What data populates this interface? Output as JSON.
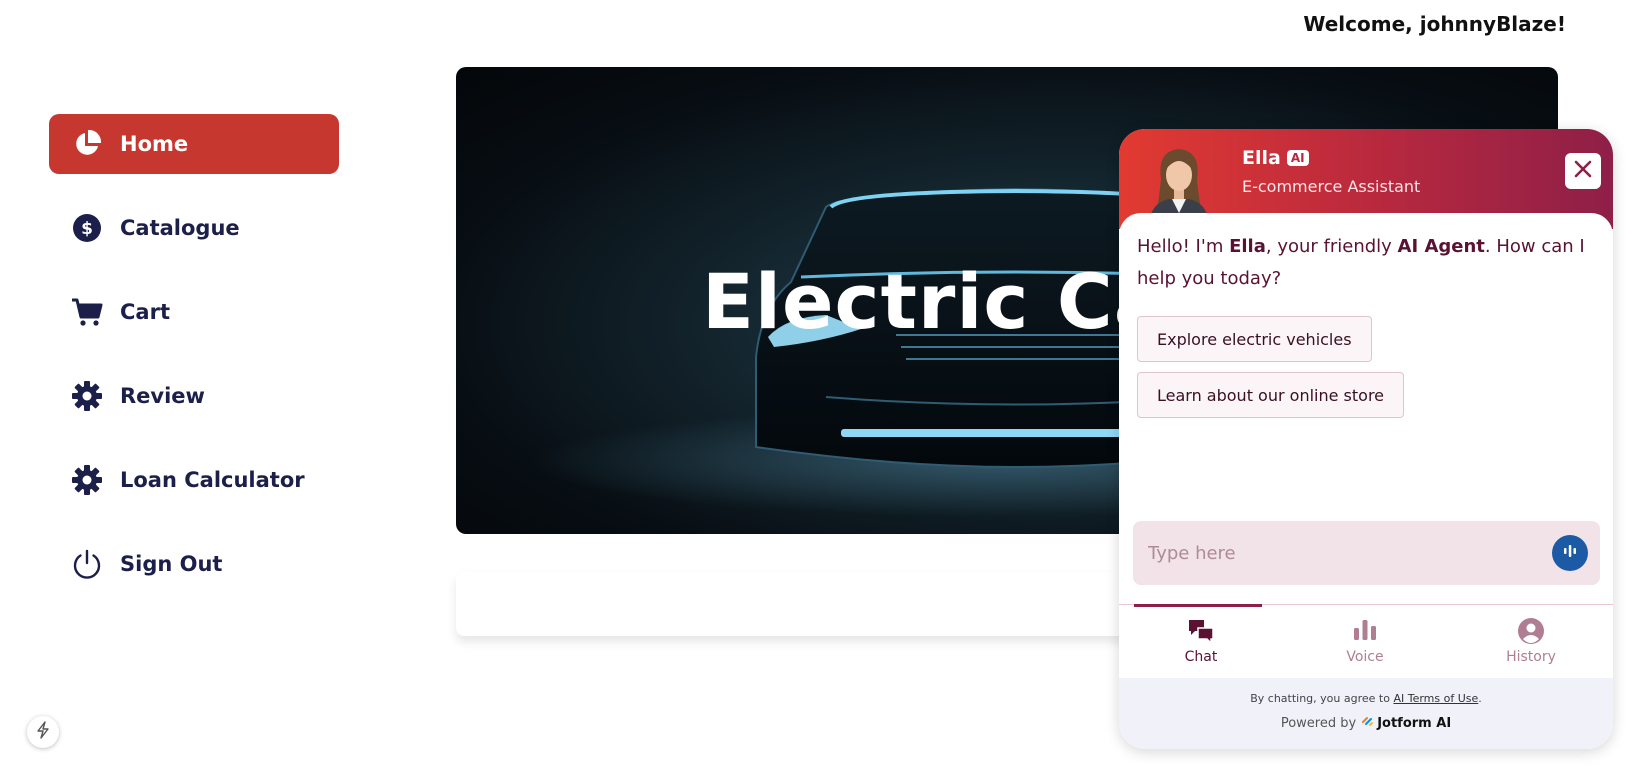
{
  "header": {
    "welcome": "Welcome, johnnyBlaze!"
  },
  "sidebar": {
    "items": [
      {
        "label": "Home",
        "icon": "pie-chart-icon",
        "active": true
      },
      {
        "label": "Catalogue",
        "icon": "dollar-icon"
      },
      {
        "label": "Cart",
        "icon": "cart-icon"
      },
      {
        "label": "Review",
        "icon": "gear-icon"
      },
      {
        "label": "Loan Calculator",
        "icon": "gear-icon"
      },
      {
        "label": "Sign Out",
        "icon": "power-icon"
      }
    ]
  },
  "hero": {
    "title": "Electric Cars"
  },
  "chat": {
    "agent_name": "Ella",
    "ai_badge": "AI",
    "agent_role": "E-commerce Assistant",
    "greeting_part1": "Hello! I'm ",
    "greeting_name": "Ella",
    "greeting_part2": ", your friendly ",
    "greeting_agent": "AI Agent",
    "greeting_part3": ". How can I help you today?",
    "suggestions": [
      "Explore electric vehicles",
      "Learn about our online store"
    ],
    "input_placeholder": "Type here",
    "tabs": [
      {
        "label": "Chat",
        "icon": "chat-icon",
        "active": true
      },
      {
        "label": "Voice",
        "icon": "voice-bars-icon"
      },
      {
        "label": "History",
        "icon": "user-icon"
      }
    ],
    "terms_prefix": "By chatting, you agree to ",
    "terms_link": "AI Terms of Use",
    "terms_suffix": ".",
    "powered_prefix": "Powered by",
    "powered_brand": "Jotform AI"
  },
  "colors": {
    "accent": "#c6382f",
    "nav_text": "#1c1f4a",
    "chat_header_start": "#e23a31",
    "chat_header_end": "#8e1f48",
    "voice_button": "#1c5aa6"
  }
}
